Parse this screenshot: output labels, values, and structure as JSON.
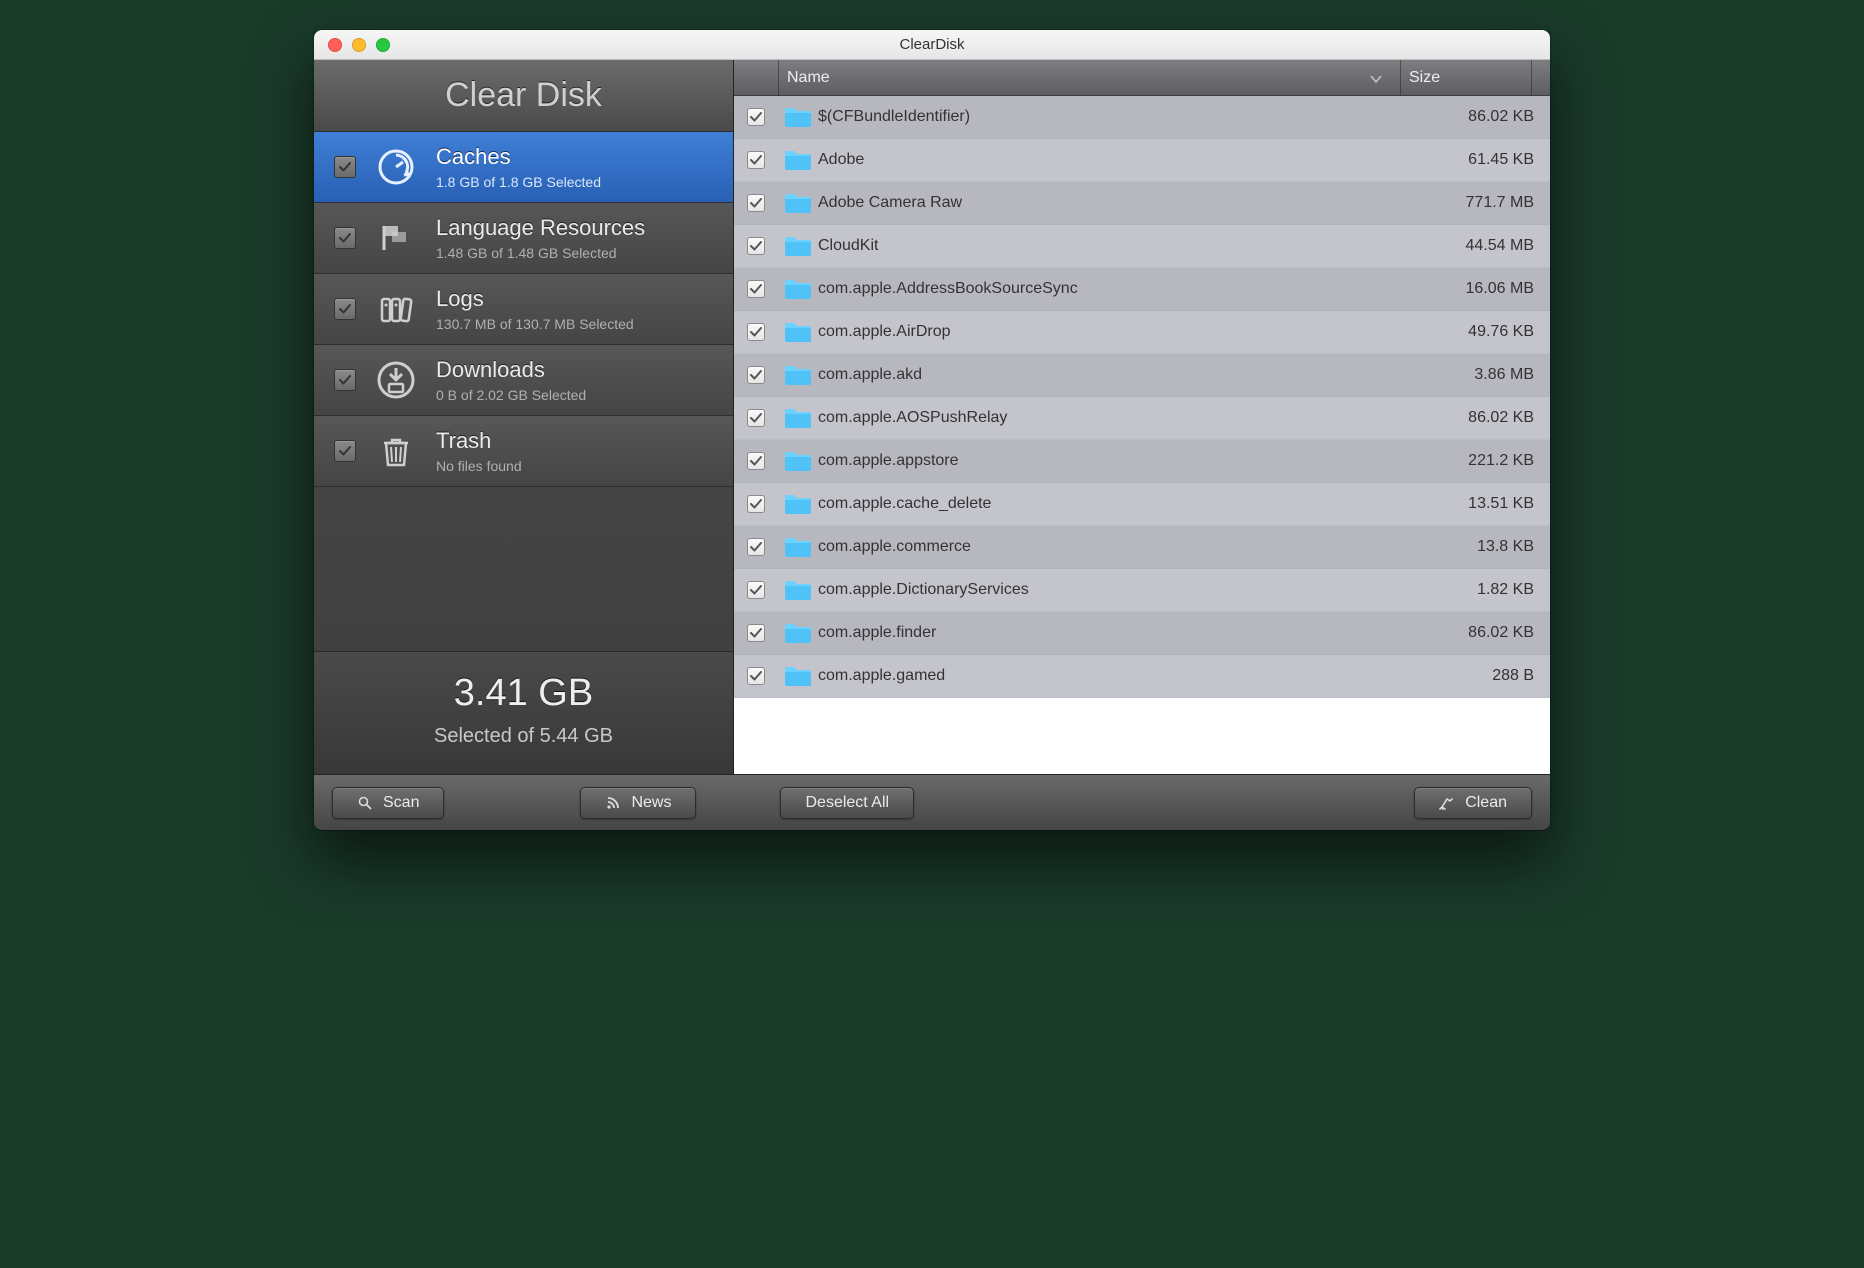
{
  "window_title": "ClearDisk",
  "app_name": "Clear Disk",
  "categories": [
    {
      "id": "caches",
      "name": "Caches",
      "sub": "1.8 GB of 1.8 GB Selected",
      "active": true
    },
    {
      "id": "language",
      "name": "Language Resources",
      "sub": "1.48 GB of 1.48 GB Selected",
      "active": false
    },
    {
      "id": "logs",
      "name": "Logs",
      "sub": "130.7 MB of 130.7 MB Selected",
      "active": false
    },
    {
      "id": "downloads",
      "name": "Downloads",
      "sub": "0 B of 2.02 GB Selected",
      "active": false
    },
    {
      "id": "trash",
      "name": "Trash",
      "sub": "No files found",
      "active": false
    }
  ],
  "summary": {
    "selected": "3.41 GB",
    "total_line": "Selected of 5.44 GB"
  },
  "columns": {
    "name": "Name",
    "size": "Size"
  },
  "files": [
    {
      "name": "$(CFBundleIdentifier)",
      "size": "86.02 KB"
    },
    {
      "name": "Adobe",
      "size": "61.45 KB"
    },
    {
      "name": "Adobe Camera Raw",
      "size": "771.7 MB"
    },
    {
      "name": "CloudKit",
      "size": "44.54 MB"
    },
    {
      "name": "com.apple.AddressBookSourceSync",
      "size": "16.06 MB"
    },
    {
      "name": "com.apple.AirDrop",
      "size": "49.76 KB"
    },
    {
      "name": "com.apple.akd",
      "size": "3.86 MB"
    },
    {
      "name": "com.apple.AOSPushRelay",
      "size": "86.02 KB"
    },
    {
      "name": "com.apple.appstore",
      "size": "221.2 KB"
    },
    {
      "name": "com.apple.cache_delete",
      "size": "13.51 KB"
    },
    {
      "name": "com.apple.commerce",
      "size": "13.8 KB"
    },
    {
      "name": "com.apple.DictionaryServices",
      "size": "1.82 KB"
    },
    {
      "name": "com.apple.finder",
      "size": "86.02 KB"
    },
    {
      "name": "com.apple.gamed",
      "size": "288 B"
    }
  ],
  "buttons": {
    "scan": "Scan",
    "news": "News",
    "deselect": "Deselect All",
    "clean": "Clean"
  }
}
